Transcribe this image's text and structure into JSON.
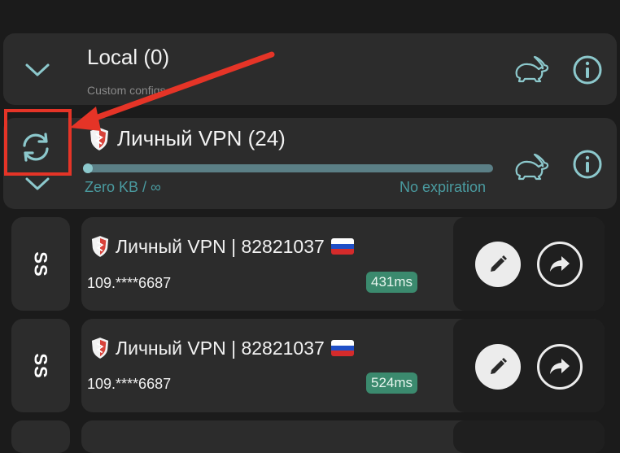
{
  "local_group": {
    "title": "Local (0)",
    "subtitle": "Custom configs"
  },
  "vpn_group": {
    "title": "Личный VPN (24)",
    "usage": "Zero KB / ∞",
    "expiration": "No expiration",
    "usage_fraction": 0.0
  },
  "servers": [
    {
      "protocol": "SS",
      "name": "Личный VPN | 82821037",
      "address": "109.****6687",
      "ping": "431ms"
    },
    {
      "protocol": "SS",
      "name": "Личный VPN | 82821037",
      "address": "109.****6687",
      "ping": "524ms"
    }
  ],
  "colors": {
    "background": "#1b1b1b",
    "card": "#2c2c2c",
    "accent_teal": "#8cc8cc",
    "ping_green": "#3b8a6e",
    "annotation_red": "#e53427"
  },
  "icons": {
    "expand": "chevron-down-icon",
    "speed": "rabbit-icon",
    "info": "info-icon",
    "refresh": "refresh-icon",
    "edit": "pencil-icon",
    "share": "share-icon",
    "shield": "shield-icon",
    "flag": "russia-flag-icon"
  }
}
